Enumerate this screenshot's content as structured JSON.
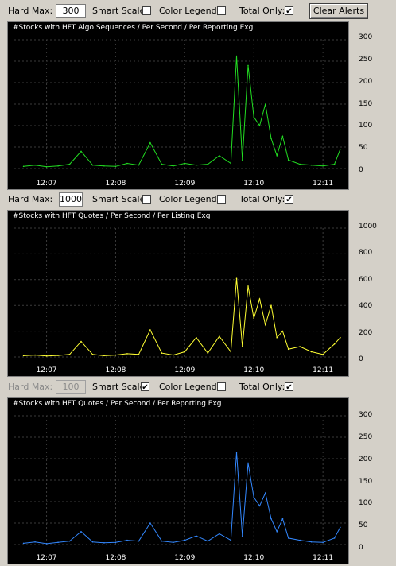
{
  "panels": [
    {
      "controls": {
        "hard_max_label": "Hard Max:",
        "hard_max_value": "300",
        "hard_max_disabled": false,
        "smart_scale_label": "Smart Scale:",
        "smart_scale_checked": false,
        "color_legend_label": "Color Legend:",
        "color_legend_checked": false,
        "total_only_label": "Total Only:",
        "total_only_checked": true,
        "clear_button_label": "Clear Alerts"
      },
      "title": "#Stocks with HFT Algo Sequences / Per Second / Per Reporting Exg",
      "color": "#22dd22",
      "y_ticks": [
        "300",
        "250",
        "200",
        "150",
        "100",
        "50",
        "0"
      ],
      "x_ticks": [
        "12:07",
        "12:08",
        "12:09",
        "12:10",
        "12:11"
      ]
    },
    {
      "controls": {
        "hard_max_label": "Hard Max:",
        "hard_max_value": "1000",
        "hard_max_disabled": false,
        "smart_scale_label": "Smart Scale:",
        "smart_scale_checked": false,
        "color_legend_label": "Color Legend:",
        "color_legend_checked": false,
        "total_only_label": "Total Only:",
        "total_only_checked": true
      },
      "title": "#Stocks with HFT Quotes / Per Second / Per Listing Exg",
      "color": "#ffff33",
      "y_ticks": [
        "1000",
        "800",
        "600",
        "400",
        "200",
        "0"
      ],
      "x_ticks": [
        "12:07",
        "12:08",
        "12:09",
        "12:10",
        "12:11"
      ]
    },
    {
      "controls": {
        "hard_max_label": "Hard Max:",
        "hard_max_value": "100",
        "hard_max_disabled": true,
        "smart_scale_label": "Smart Scale:",
        "smart_scale_checked": true,
        "color_legend_label": "Color Legend:",
        "color_legend_checked": false,
        "total_only_label": "Total Only:",
        "total_only_checked": true
      },
      "title": "#Stocks with HFT Quotes / Per Second / Per Reporting Exg",
      "color": "#3388ff",
      "y_ticks": [
        "300",
        "250",
        "200",
        "150",
        "100",
        "50",
        "0"
      ],
      "x_ticks": [
        "12:07",
        "12:08",
        "12:09",
        "12:10",
        "12:11"
      ]
    }
  ],
  "chart_data": [
    {
      "type": "line",
      "title": "#Stocks with HFT Algo Sequences / Per Second / Per Reporting Exg",
      "x": [
        "12:06:40",
        "12:06:50",
        "12:07:00",
        "12:07:10",
        "12:07:20",
        "12:07:30",
        "12:07:40",
        "12:07:50",
        "12:08:00",
        "12:08:10",
        "12:08:20",
        "12:08:30",
        "12:08:40",
        "12:08:50",
        "12:09:00",
        "12:09:10",
        "12:09:20",
        "12:09:30",
        "12:09:40",
        "12:09:45",
        "12:09:50",
        "12:09:55",
        "12:10:00",
        "12:10:05",
        "12:10:10",
        "12:10:15",
        "12:10:20",
        "12:10:25",
        "12:10:30",
        "12:10:40",
        "12:10:50",
        "12:11:00",
        "12:11:10",
        "12:11:15"
      ],
      "series": [
        {
          "values": [
            5,
            8,
            4,
            6,
            10,
            40,
            8,
            6,
            5,
            12,
            8,
            60,
            10,
            6,
            12,
            8,
            10,
            30,
            12,
            262,
            20,
            240,
            120,
            100,
            150,
            70,
            30,
            75,
            20,
            10,
            8,
            6,
            10,
            45
          ]
        }
      ],
      "ylim": [
        0,
        300
      ],
      "grid": true
    },
    {
      "type": "line",
      "title": "#Stocks with HFT Quotes / Per Second / Per Listing Exg",
      "x": [
        "12:06:40",
        "12:06:50",
        "12:07:00",
        "12:07:10",
        "12:07:20",
        "12:07:30",
        "12:07:40",
        "12:07:50",
        "12:08:00",
        "12:08:10",
        "12:08:20",
        "12:08:30",
        "12:08:40",
        "12:08:50",
        "12:09:00",
        "12:09:10",
        "12:09:20",
        "12:09:30",
        "12:09:40",
        "12:09:45",
        "12:09:50",
        "12:09:55",
        "12:10:00",
        "12:10:05",
        "12:10:10",
        "12:10:15",
        "12:10:20",
        "12:10:25",
        "12:10:30",
        "12:10:40",
        "12:10:50",
        "12:11:00",
        "12:11:10",
        "12:11:15"
      ],
      "series": [
        {
          "values": [
            10,
            15,
            8,
            12,
            20,
            120,
            20,
            10,
            15,
            25,
            20,
            210,
            30,
            15,
            40,
            150,
            30,
            160,
            40,
            610,
            80,
            550,
            300,
            450,
            250,
            400,
            150,
            200,
            60,
            80,
            40,
            20,
            100,
            150
          ]
        }
      ],
      "ylim": [
        0,
        1000
      ],
      "grid": true
    },
    {
      "type": "line",
      "title": "#Stocks with HFT Quotes / Per Second / Per Reporting Exg",
      "x": [
        "12:06:40",
        "12:06:50",
        "12:07:00",
        "12:07:10",
        "12:07:20",
        "12:07:30",
        "12:07:40",
        "12:07:50",
        "12:08:00",
        "12:08:10",
        "12:08:20",
        "12:08:30",
        "12:08:40",
        "12:08:50",
        "12:09:00",
        "12:09:10",
        "12:09:20",
        "12:09:30",
        "12:09:40",
        "12:09:45",
        "12:09:50",
        "12:09:55",
        "12:10:00",
        "12:10:05",
        "12:10:10",
        "12:10:15",
        "12:10:20",
        "12:10:25",
        "12:10:30",
        "12:10:40",
        "12:10:50",
        "12:11:00",
        "12:11:10",
        "12:11:15"
      ],
      "series": [
        {
          "values": [
            3,
            6,
            2,
            5,
            8,
            30,
            6,
            4,
            5,
            10,
            8,
            50,
            8,
            5,
            10,
            20,
            8,
            25,
            10,
            215,
            20,
            190,
            110,
            90,
            120,
            60,
            30,
            60,
            15,
            10,
            6,
            5,
            15,
            40
          ]
        }
      ],
      "ylim": [
        0,
        300
      ],
      "grid": true
    }
  ]
}
